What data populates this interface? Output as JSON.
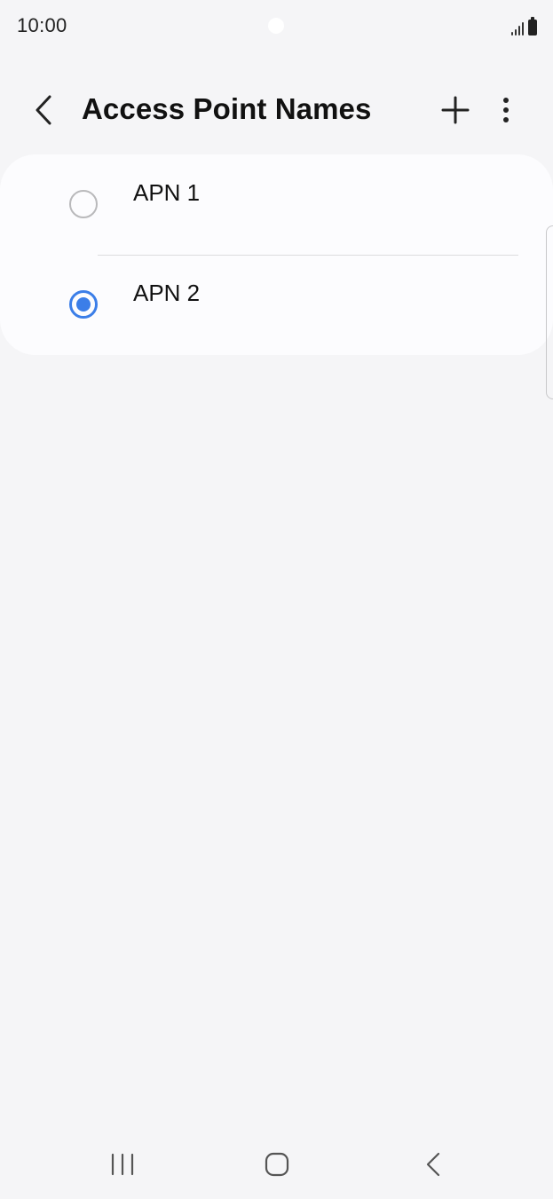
{
  "status_bar": {
    "time": "10:00",
    "icons": [
      "camera-cutout",
      "signal-icon",
      "battery-icon"
    ]
  },
  "app_bar": {
    "title": "Access Point Names",
    "back_icon": "chevron-left-icon",
    "add_icon": "plus-icon",
    "more_icon": "more-vertical-icon"
  },
  "apn_list": {
    "items": [
      {
        "label": "APN 1",
        "selected": false
      },
      {
        "label": "APN 2",
        "selected": true
      }
    ]
  },
  "navigation_bar": {
    "icons": [
      "recents-icon",
      "home-icon",
      "back-icon"
    ]
  },
  "colors": {
    "background": "#f5f5f7",
    "card": "#fcfcfe",
    "accent": "#3b7ee8",
    "radio_unchecked": "#b9b9bb",
    "divider": "#dcdcde",
    "text": "#111111"
  }
}
